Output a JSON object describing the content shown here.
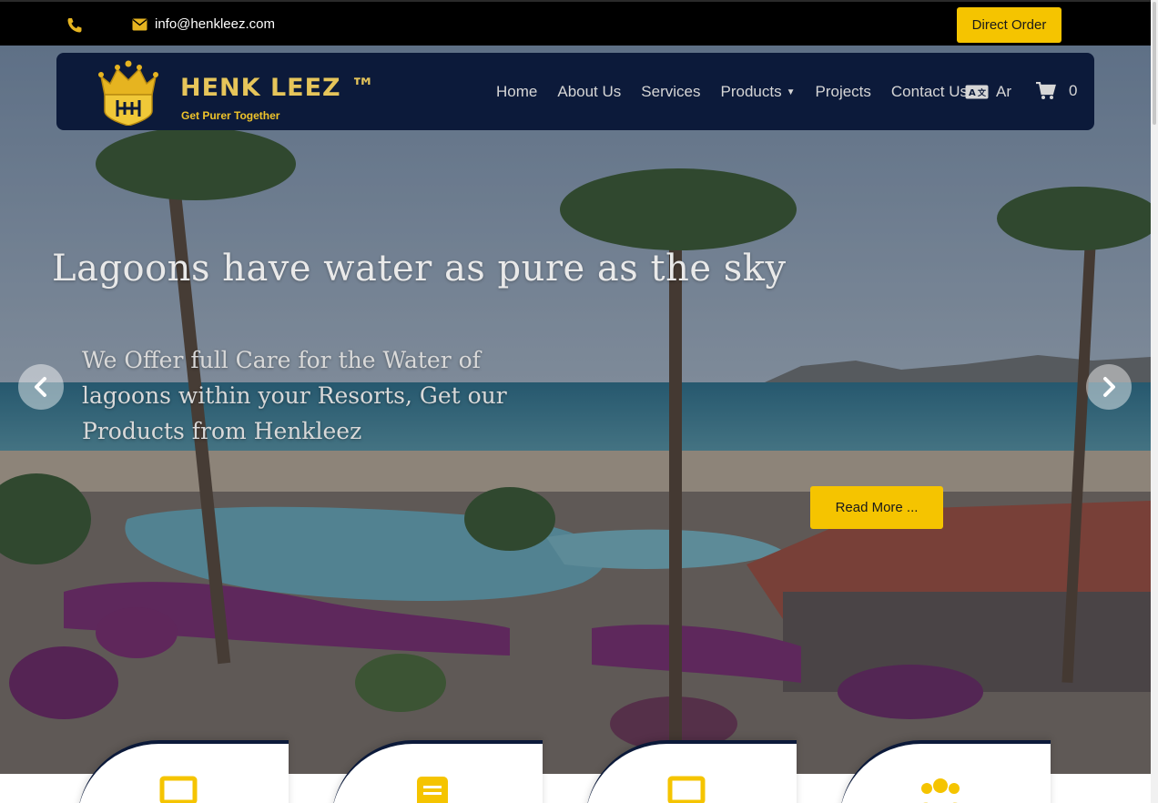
{
  "topbar": {
    "phone_icon": "phone-icon",
    "mail_icon": "envelope-icon",
    "email": "info@henkleez.com",
    "direct_order_label": "Direct Order"
  },
  "brand": {
    "logo_icon": "crown-logo-icon",
    "name": "HENK LEEZ ™",
    "tagline": "Get Purer Together"
  },
  "nav": {
    "items": [
      {
        "label": "Home"
      },
      {
        "label": "About Us"
      },
      {
        "label": "Services"
      },
      {
        "label": "Products",
        "has_dropdown": true
      },
      {
        "label": "Projects"
      },
      {
        "label": "Contact Us"
      }
    ],
    "language_icon": "translate-icon",
    "language_label": "Ar",
    "cart_icon": "cart-icon",
    "cart_count": "0"
  },
  "hero": {
    "title": "Lagoons have water as pure as the sky",
    "subtitle": "We Offer full Care for the Water of lagoons within your Resorts, Get our Products from Henkleez",
    "read_more_label": "Read More ...",
    "prev_icon": "chevron-left-icon",
    "next_icon": "chevron-right-icon"
  },
  "feature_cards": [
    {
      "icon": "laptop-icon"
    },
    {
      "icon": "document-icon"
    },
    {
      "icon": "laptop-icon"
    },
    {
      "icon": "users-icon"
    }
  ],
  "colors": {
    "accent": "#f5c400",
    "navy": "#0c1a3a",
    "gold_text": "#e6c55a"
  }
}
